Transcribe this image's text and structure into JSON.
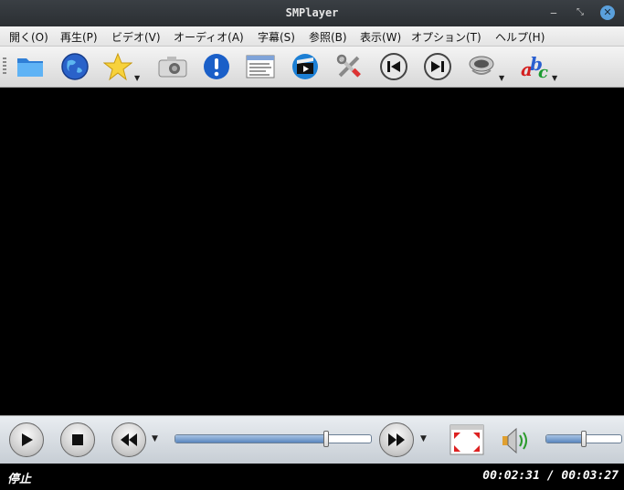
{
  "window": {
    "title": "SMPlayer"
  },
  "menubar": {
    "items": [
      "開く(O)",
      "再生(P)",
      "ビデオ(V)",
      "オーディオ(A)",
      "字幕(S)",
      "参照(B)",
      "表示(W)",
      "オプション(T)",
      "ヘルプ(H)"
    ]
  },
  "toolbar": {
    "icons": [
      "folder-icon",
      "globe-icon",
      "favorites-star-icon",
      "screenshot-camera-icon",
      "info-icon",
      "playlist-icon",
      "media-clapper-icon",
      "preferences-tools-icon",
      "previous-icon",
      "next-icon",
      "audio-icon",
      "subtitles-icon"
    ]
  },
  "controls": {
    "seek_progress_percent": 77,
    "volume_percent": 50
  },
  "status": {
    "state": "停止",
    "time": "00:02:31 / 00:03:27"
  },
  "colors": {
    "title_bar": "#2f3338",
    "accent": "#5a86bf",
    "status_bg": "#000000"
  }
}
